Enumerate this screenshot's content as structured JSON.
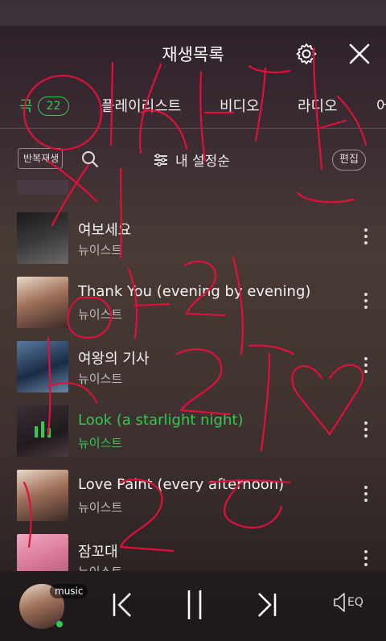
{
  "header": {
    "title": "재생목록"
  },
  "tabs": [
    {
      "label": "곡",
      "badge": "22",
      "active": true
    },
    {
      "label": "플레이리스트"
    },
    {
      "label": "비디오"
    },
    {
      "label": "라디오"
    },
    {
      "label": "어"
    }
  ],
  "toolbar": {
    "repeat_label": "반복재생",
    "sort_label": "내 설정순",
    "edit_label": "편집"
  },
  "songs": [
    {
      "title": "여보세요",
      "artist": "뉴이스트"
    },
    {
      "title": "Thank You (evening by evening)",
      "artist": "뉴이스트"
    },
    {
      "title": "여왕의 기사",
      "artist": "뉴이스트"
    },
    {
      "title": "Look (a starlight night)",
      "artist": "뉴이스트",
      "playing": true
    },
    {
      "title": "Love Paint (every afternoon)",
      "artist": "뉴이스트"
    },
    {
      "title": "잠꼬대",
      "artist": "뉴이스트"
    }
  ],
  "player": {
    "source_badge": "music",
    "eq_label": "EQ"
  },
  "colors": {
    "accent": "#2ecc4f",
    "scribble": "#e0103a"
  }
}
